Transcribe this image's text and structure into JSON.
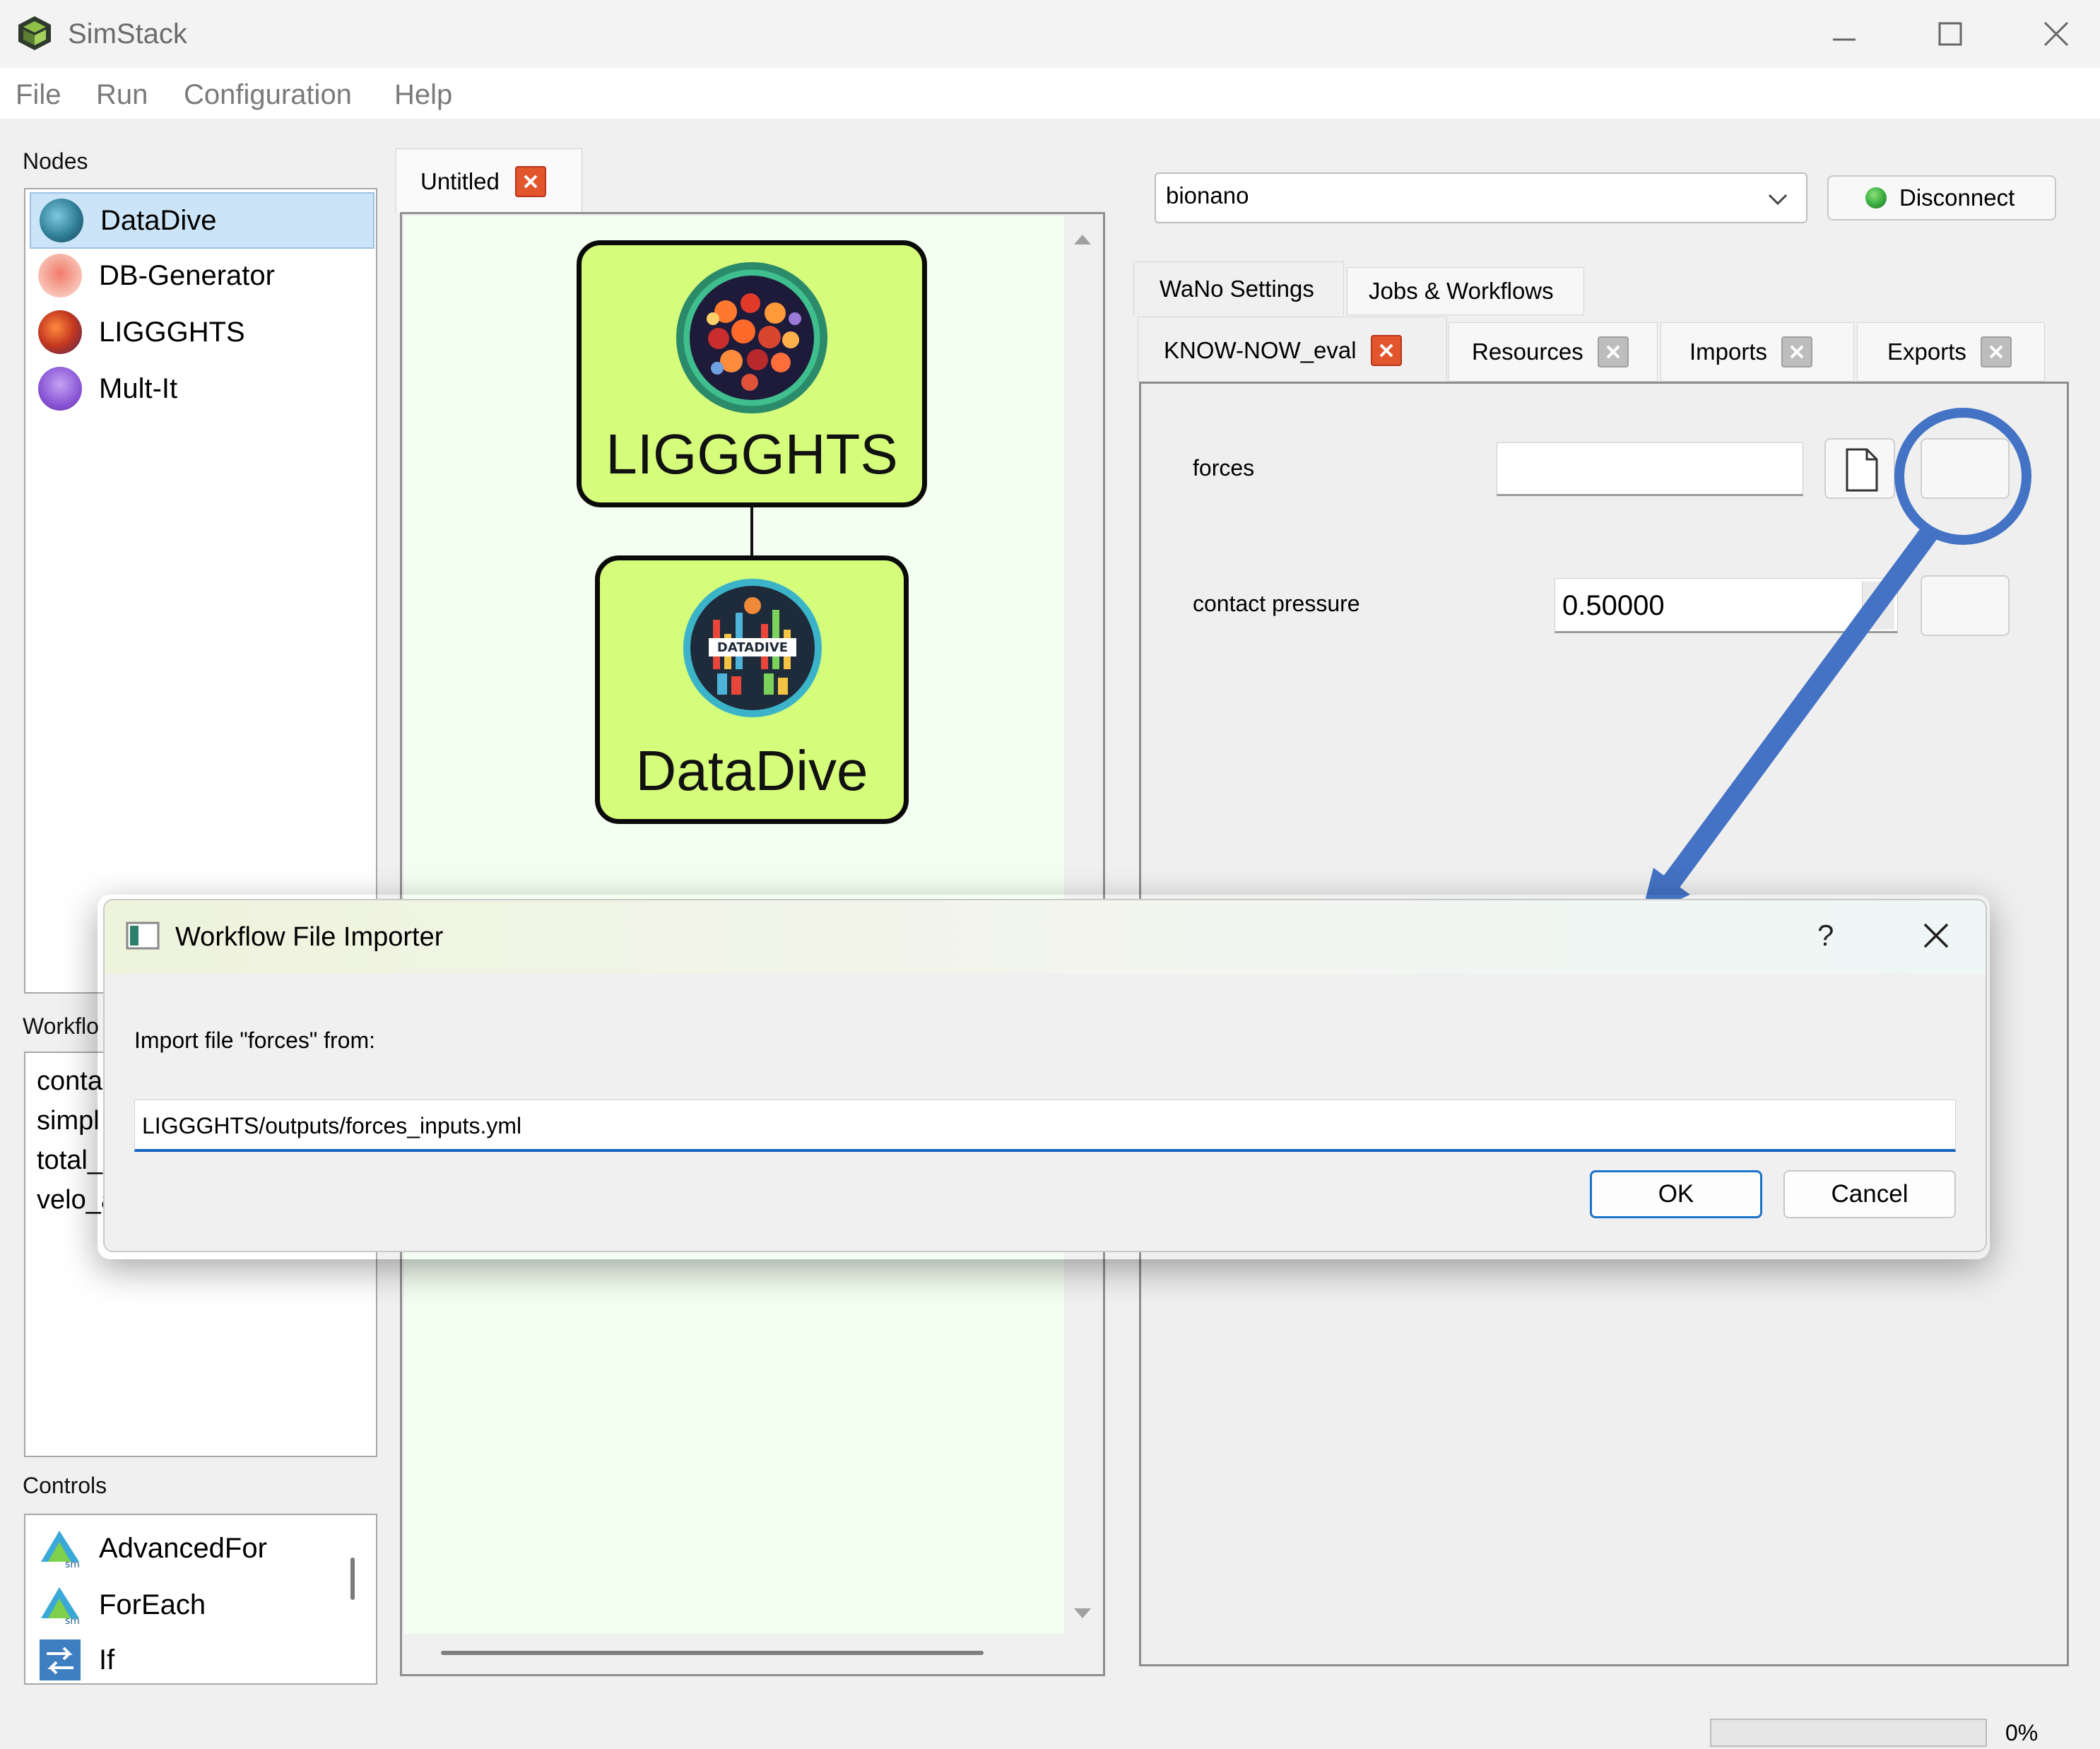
{
  "app": {
    "title": "SimStack",
    "menu": [
      "File",
      "Run",
      "Configuration",
      "Help"
    ]
  },
  "nodes": {
    "label": "Nodes",
    "items": [
      {
        "label": "DataDive",
        "icon": "datadive-icon",
        "selected": true
      },
      {
        "label": "DB-Generator",
        "icon": "db-generator-icon"
      },
      {
        "label": "LIGGGHTS",
        "icon": "liggghts-icon"
      },
      {
        "label": "Mult-It",
        "icon": "mult-it-icon"
      }
    ]
  },
  "workflow_vars": {
    "label": "Workflo",
    "items": [
      "conta",
      "simpl",
      "total_",
      "velo_a"
    ]
  },
  "controls": {
    "label": "Controls",
    "items": [
      {
        "label": "AdvancedFor",
        "icon": "advancedfor-icon"
      },
      {
        "label": "ForEach",
        "icon": "foreach-icon"
      },
      {
        "label": "If",
        "icon": "if-icon"
      }
    ]
  },
  "canvas": {
    "tab_label": "Untitled",
    "nodes": [
      {
        "label": "LIGGGHTS",
        "icon": "liggghts-icon"
      },
      {
        "label": "DataDive",
        "icon": "datadive-icon",
        "logo_text": "DATADIVE"
      }
    ]
  },
  "server": {
    "selected": "bionano",
    "connect_button": "Disconnect",
    "status_color": "#3cb043"
  },
  "right_tabs": {
    "top": [
      "WaNo Settings",
      "Jobs & Workflows"
    ],
    "sub": [
      "KNOW-NOW_eval",
      "Resources",
      "Imports",
      "Exports"
    ]
  },
  "wano": {
    "fields": [
      {
        "label": "forces",
        "value": ""
      },
      {
        "label": "contact pressure",
        "value": "0.50000"
      }
    ]
  },
  "dialog": {
    "title": "Workflow File Importer",
    "help_symbol": "?",
    "prompt": "Import file \"forces\" from:",
    "input_value": "LIGGGHTS/outputs/forces_inputs.yml",
    "ok": "OK",
    "cancel": "Cancel"
  },
  "status": {
    "progress_text": "0%",
    "progress": 0
  },
  "colors": {
    "annotation_blue": "#4472c4",
    "node_fill": "#d5fc7b",
    "selection": "#cce4f7",
    "close_red": "#e2562e",
    "input_accent": "#1565c0"
  }
}
